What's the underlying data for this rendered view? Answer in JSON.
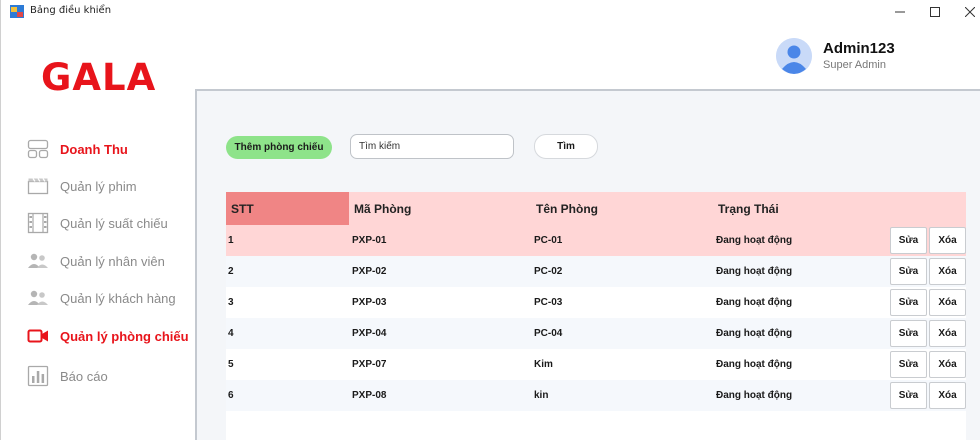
{
  "window": {
    "title": "Bảng điều khiển"
  },
  "brand": {
    "logo": "GALA",
    "accent_color": "#e8141b"
  },
  "user": {
    "name": "Admin123",
    "role": "Super Admin"
  },
  "sidebar": {
    "items": [
      {
        "label": "Doanh Thu",
        "icon": "revenue-dashboard-icon",
        "active": false,
        "highlight": true
      },
      {
        "label": "Quản lý phim",
        "icon": "clapperboard-icon",
        "active": false
      },
      {
        "label": "Quản lý suất chiếu",
        "icon": "film-strip-icon",
        "active": false
      },
      {
        "label": "Quản lý nhân viên",
        "icon": "users-icon",
        "active": false
      },
      {
        "label": "Quản lý khách hàng",
        "icon": "customers-icon",
        "active": false
      },
      {
        "label": "Quản lý phòng chiếu",
        "icon": "video-camera-icon",
        "active": true
      },
      {
        "label": "Báo cáo",
        "icon": "bar-chart-icon",
        "active": false
      }
    ]
  },
  "toolbar": {
    "add_label": "Thêm phòng chiếu",
    "search_placeholder": "Tìm kiếm",
    "find_label": "Tìm"
  },
  "table": {
    "columns": [
      "STT",
      "Mã Phòng",
      "Tên Phòng",
      "Trạng Thái"
    ],
    "edit_label": "Sửa",
    "delete_label": "Xóa",
    "rows": [
      {
        "stt": "1",
        "ma": "PXP-01",
        "ten": "PC-01",
        "trang_thai": "Đang hoạt động"
      },
      {
        "stt": "2",
        "ma": "PXP-02",
        "ten": "PC-02",
        "trang_thai": "Đang hoạt động"
      },
      {
        "stt": "3",
        "ma": "PXP-03",
        "ten": "PC-03",
        "trang_thai": "Đang hoạt động"
      },
      {
        "stt": "4",
        "ma": "PXP-04",
        "ten": "PC-04",
        "trang_thai": "Đang hoạt động"
      },
      {
        "stt": "5",
        "ma": "PXP-07",
        "ten": "Kim",
        "trang_thai": "Đang hoạt động"
      },
      {
        "stt": "6",
        "ma": "PXP-08",
        "ten": "kin",
        "trang_thai": "Đang hoạt động"
      }
    ]
  }
}
